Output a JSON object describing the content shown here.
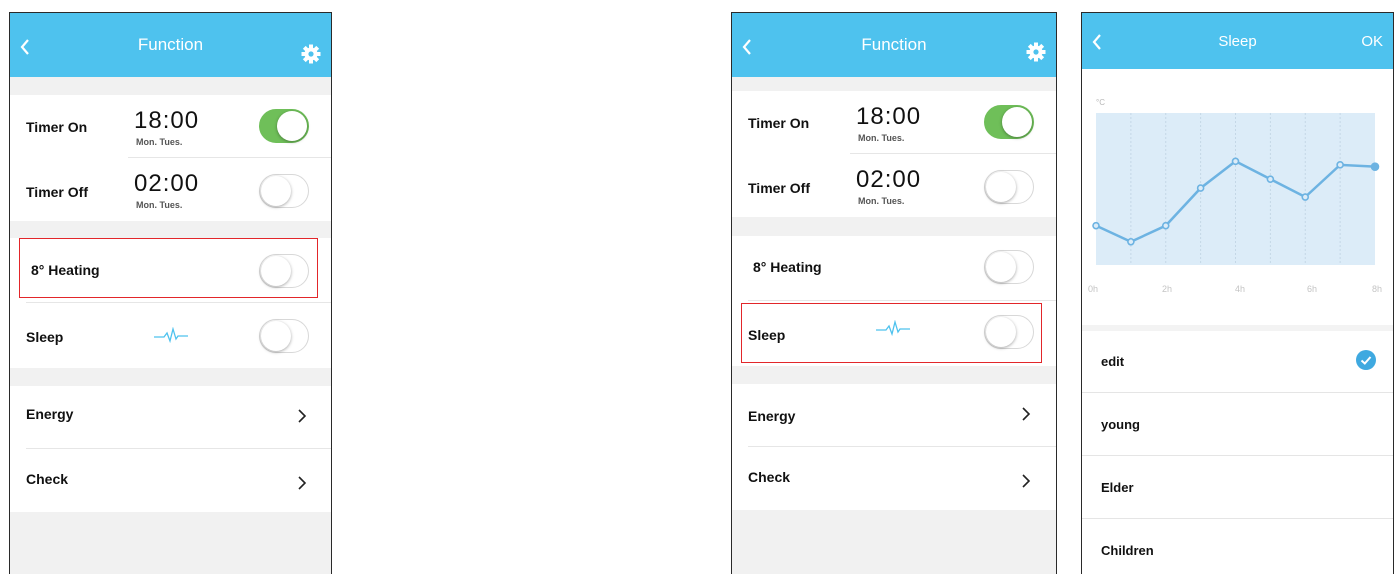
{
  "function_screen": {
    "title": "Function",
    "timer_on": {
      "label": "Timer On",
      "time": "18:00",
      "days": "Mon. Tues.",
      "enabled": true
    },
    "timer_off": {
      "label": "Timer Off",
      "time": "02:00",
      "days": "Mon. Tues.",
      "enabled": false
    },
    "heating": {
      "label": "8° Heating",
      "enabled": false
    },
    "sleep": {
      "label": "Sleep",
      "enabled": false
    },
    "energy": {
      "label": "Energy"
    },
    "check": {
      "label": "Check"
    }
  },
  "sleep_screen": {
    "title": "Sleep",
    "ok_label": "OK",
    "unit_label": "°C",
    "options": [
      {
        "label": "edit",
        "selected": true
      },
      {
        "label": "young",
        "selected": false
      },
      {
        "label": "Elder",
        "selected": false
      },
      {
        "label": "Children",
        "selected": false
      }
    ]
  },
  "chart_data": {
    "type": "line",
    "x": [
      "0h",
      "1h",
      "2h",
      "3h",
      "4h",
      "5h",
      "6h",
      "7h",
      "8h"
    ],
    "tick_labels": [
      "0h",
      "2h",
      "4h",
      "6h",
      "8h"
    ],
    "values": [
      2.2,
      1.3,
      2.2,
      4.3,
      5.8,
      4.8,
      3.8,
      5.6,
      5.5
    ],
    "ylim": [
      0,
      8.5
    ],
    "ylabel": "°C",
    "grid": true
  },
  "colors": {
    "header": "#4ec2ee",
    "toggle_on": "#6fbf59",
    "highlight": "#e2262a",
    "accent": "#3fa9e0"
  }
}
